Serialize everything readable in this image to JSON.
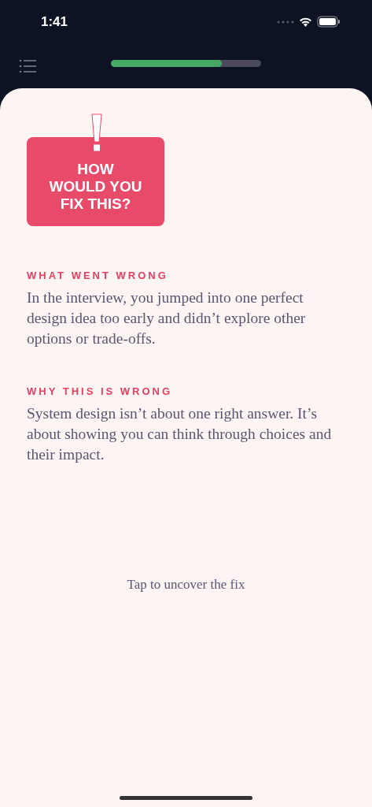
{
  "status_bar": {
    "time": "1:41"
  },
  "progress": {
    "level": 0.74
  },
  "sign": {
    "lines": [
      "HOW",
      "WOULD YOU",
      "FIX THIS?"
    ]
  },
  "sections": [
    {
      "heading": "WHAT WENT WRONG",
      "body": "In the interview, you jumped into one perfect design idea too early and didn’t explore other options or trade-offs."
    },
    {
      "heading": "WHY THIS IS WRONG",
      "body": "System design isn’t about one right answer. It’s about showing you can think through choices and their impact."
    }
  ],
  "reveal_hint": "Tap to uncover the fix"
}
